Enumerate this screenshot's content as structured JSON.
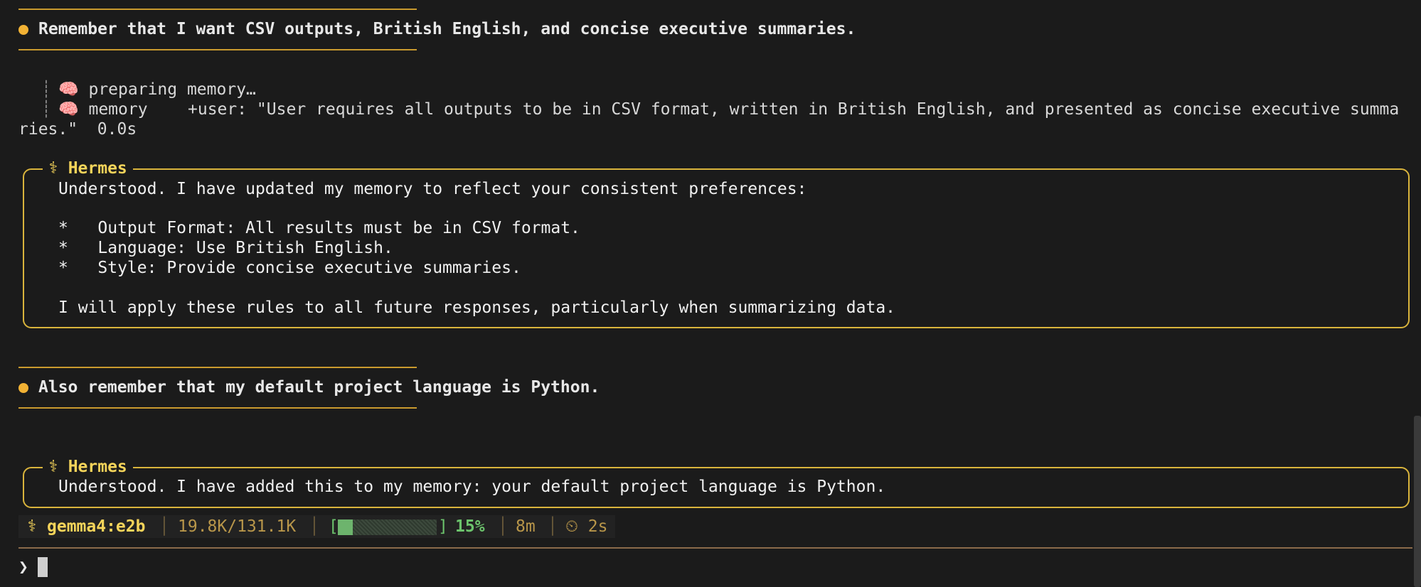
{
  "conversation": {
    "user_message_1": "Remember that I want CSV outputs, British English, and concise executive summaries.",
    "tool_lines": {
      "preparing": "🧠 preparing memory…",
      "memory_label": "🧠 memory",
      "memory_detail_line1": "+user: \"User requires all outputs to be in CSV format, written in British English, and presented as concise executive summa",
      "memory_detail_line2": "ries.\"  0.0s"
    },
    "assistant_1": {
      "title": "⚕ Hermes",
      "intro": "Understood. I have updated my memory to reflect your consistent preferences:",
      "bullets": [
        "*   Output Format: All results must be in CSV format.",
        "*   Language: Use British English.",
        "*   Style: Provide concise executive summaries."
      ],
      "closing": "I will apply these rules to all future responses, particularly when summarizing data."
    },
    "user_message_2": "Also remember that my default project language is Python.",
    "assistant_2": {
      "title": "⚕ Hermes",
      "text": "Understood. I have added this to my memory: your default project language is Python."
    }
  },
  "status": {
    "model_icon": "⚕",
    "model": "gemma4:e2b",
    "tokens": "19.8K/131.1K",
    "context_fraction": 0.15,
    "context_percent": "15%",
    "bracket_open": "[",
    "bracket_close": "]",
    "elapsed": "8m",
    "timer": "⏲ 2s",
    "separator": "│"
  },
  "prompt": {
    "symbol": "❯"
  },
  "colors": {
    "accent": "#f5d45a",
    "rule": "#c99a2e",
    "bullet": "#f2b234",
    "progress": "#6cc36c",
    "background": "#1b1b1b"
  }
}
